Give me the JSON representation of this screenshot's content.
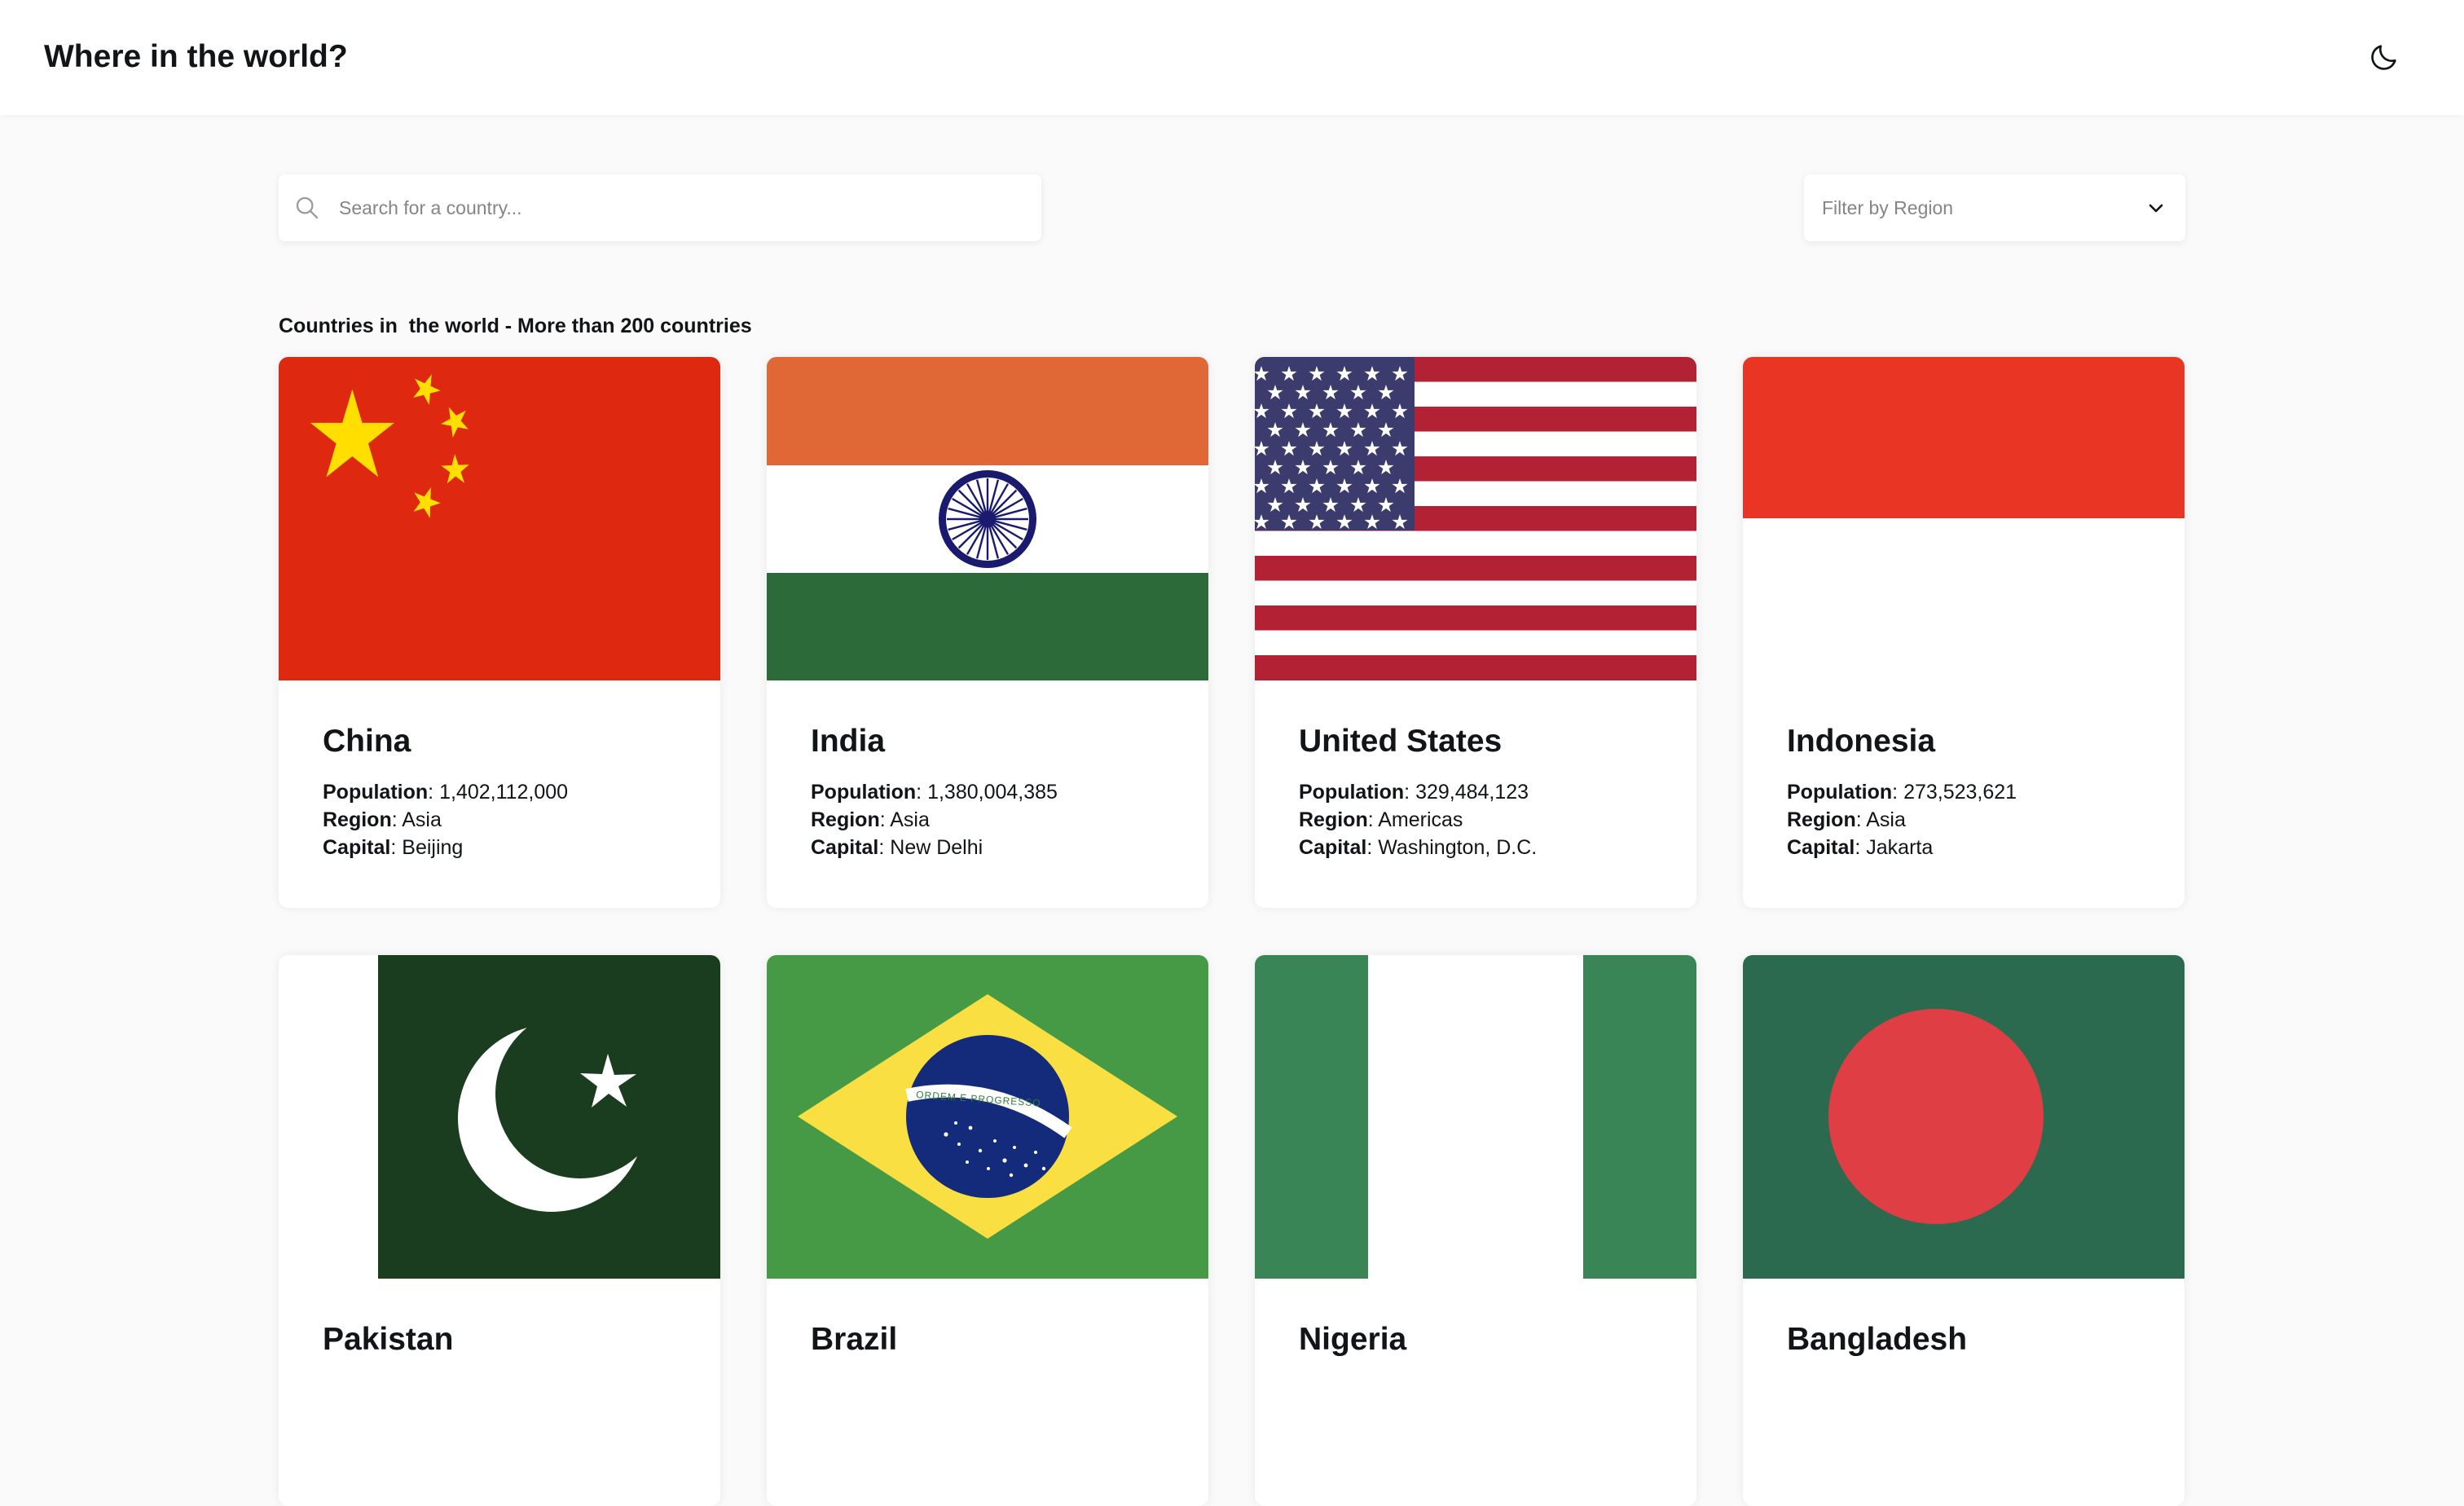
{
  "header": {
    "title": "Where in the world?",
    "theme_icon": "moon-icon"
  },
  "search": {
    "placeholder": "Search for a country...",
    "icon": "search-icon"
  },
  "filter": {
    "label": "Filter by Region",
    "icon": "chevron-down-icon"
  },
  "section": {
    "heading": "Countries in  the world - More than 200 countries"
  },
  "labels": {
    "population": "Population",
    "region": "Region",
    "capital": "Capital"
  },
  "countries": [
    {
      "name": "China",
      "population": "1,402,112,000",
      "region": "Asia",
      "capital": "Beijing"
    },
    {
      "name": "India",
      "population": "1,380,004,385",
      "region": "Asia",
      "capital": "New Delhi"
    },
    {
      "name": "United States",
      "population": "329,484,123",
      "region": "Americas",
      "capital": "Washington, D.C."
    },
    {
      "name": "Indonesia",
      "population": "273,523,621",
      "region": "Asia",
      "capital": "Jakarta"
    },
    {
      "name": "Pakistan",
      "population": "",
      "region": "",
      "capital": ""
    },
    {
      "name": "Brazil",
      "population": "",
      "region": "",
      "capital": ""
    },
    {
      "name": "Nigeria",
      "population": "",
      "region": "",
      "capital": ""
    },
    {
      "name": "Bangladesh",
      "population": "",
      "region": "",
      "capital": ""
    }
  ],
  "flag_text": {
    "brazil_motto": "ORDEM E PROGRESSO"
  },
  "colors": {
    "background": "#fafafa",
    "card": "#ffffff",
    "text": "#111517",
    "placeholder": "#858585"
  }
}
